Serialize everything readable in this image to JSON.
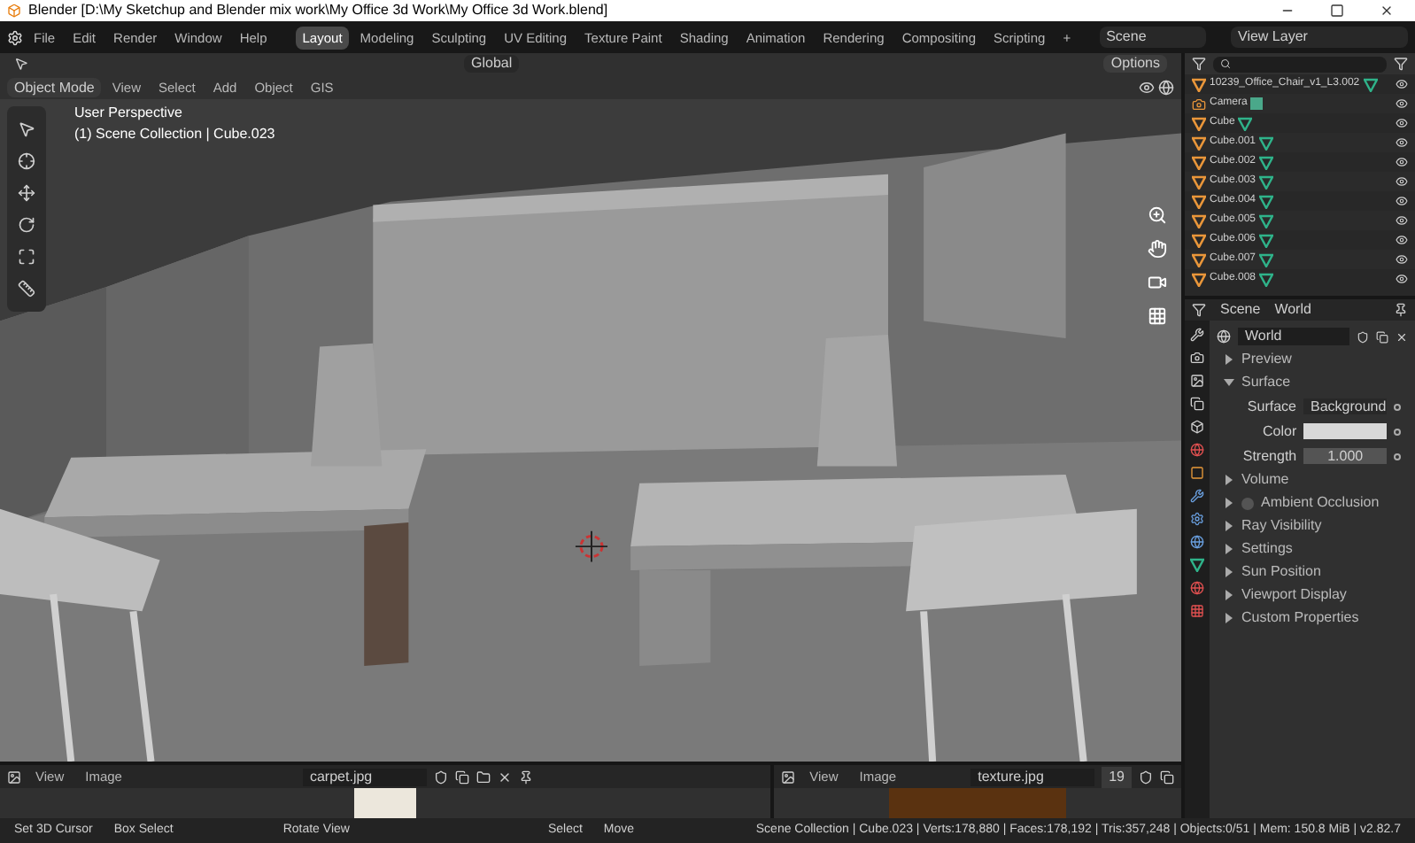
{
  "window": {
    "title": "Blender [D:\\My Sketchup and Blender mix work\\My Office 3d Work\\My Office 3d Work.blend]"
  },
  "menu": [
    "File",
    "Edit",
    "Render",
    "Window",
    "Help"
  ],
  "workspaces": [
    {
      "label": "Layout",
      "selected": true
    },
    {
      "label": "Modeling",
      "selected": false
    },
    {
      "label": "Sculpting",
      "selected": false
    },
    {
      "label": "UV Editing",
      "selected": false
    },
    {
      "label": "Texture Paint",
      "selected": false
    },
    {
      "label": "Shading",
      "selected": false
    },
    {
      "label": "Animation",
      "selected": false
    },
    {
      "label": "Rendering",
      "selected": false
    },
    {
      "label": "Compositing",
      "selected": false
    },
    {
      "label": "Scripting",
      "selected": false
    }
  ],
  "add_workspace": "+",
  "scene": "Scene",
  "view_layer": "View Layer",
  "viewport": {
    "transform": "Global",
    "options": "Options",
    "mode": "Object Mode",
    "menus": [
      "View",
      "Select",
      "Add",
      "Object",
      "GIS"
    ],
    "perspective": "User Perspective",
    "collection": "(1) Scene Collection | Cube.023"
  },
  "outliner": {
    "items": [
      {
        "name": "10239_Office_Chair_v1_L3.002",
        "kind": "mesh"
      },
      {
        "name": "Camera",
        "kind": "camera"
      },
      {
        "name": "Cube",
        "kind": "mesh"
      },
      {
        "name": "Cube.001",
        "kind": "mesh"
      },
      {
        "name": "Cube.002",
        "kind": "mesh"
      },
      {
        "name": "Cube.003",
        "kind": "mesh"
      },
      {
        "name": "Cube.004",
        "kind": "mesh"
      },
      {
        "name": "Cube.005",
        "kind": "mesh"
      },
      {
        "name": "Cube.006",
        "kind": "mesh"
      },
      {
        "name": "Cube.007",
        "kind": "mesh"
      },
      {
        "name": "Cube.008",
        "kind": "mesh"
      }
    ]
  },
  "properties": {
    "breadcrumb": [
      "Scene",
      "World"
    ],
    "world": "World",
    "panels": [
      {
        "label": "Preview",
        "kind": "panel",
        "expanded": false
      },
      {
        "label": "Surface",
        "kind": "panel",
        "expanded": true,
        "fields": [
          {
            "label": "Surface",
            "value": "Background",
            "kind": "menu"
          },
          {
            "label": "Color",
            "kind": "color"
          },
          {
            "label": "Strength",
            "value": "1.000",
            "kind": "number"
          }
        ]
      },
      {
        "label": "Volume",
        "kind": "panel",
        "expanded": false
      },
      {
        "label": "Ambient Occlusion",
        "kind": "checkbox",
        "expanded": false,
        "checked": false
      },
      {
        "label": "Ray Visibility",
        "kind": "panel",
        "expanded": false
      },
      {
        "label": "Settings",
        "kind": "panel",
        "expanded": false
      },
      {
        "label": "Sun Position",
        "kind": "panel",
        "expanded": false
      },
      {
        "label": "Viewport Display",
        "kind": "panel",
        "expanded": false
      },
      {
        "label": "Custom Properties",
        "kind": "panel",
        "expanded": false
      }
    ]
  },
  "image_editors": [
    {
      "menus": [
        "View",
        "Image"
      ],
      "image": "carpet.jpg",
      "kind": "carpet"
    },
    {
      "menus": [
        "View",
        "Image"
      ],
      "image": "texture.jpg",
      "users": "19",
      "kind": "wood"
    }
  ],
  "status_bar": {
    "hints": [
      "Set 3D Cursor",
      "Box Select",
      "Rotate View",
      "Select",
      "Move"
    ],
    "stats": "Scene Collection | Cube.023 | Verts:178,880 | Faces:178,192 | Tris:357,248 | Objects:0/51 | Mem: 150.8 MiB | v2.82.7"
  }
}
